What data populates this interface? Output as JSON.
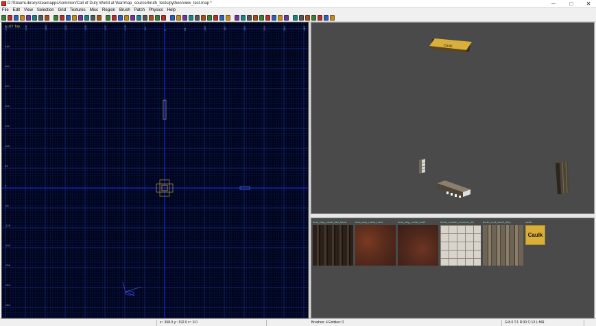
{
  "window": {
    "title": "D:/SteamLibrary/steamapps/common/Call of Duty World at War/map_source/bruth_tests/python/view_test.map *",
    "minimize": "─",
    "maximize": "□",
    "close": "✕"
  },
  "menu": [
    "File",
    "Edit",
    "View",
    "Selection",
    "Grid",
    "Textures",
    "Misc",
    "Region",
    "Brush",
    "Patch",
    "Physics",
    "Help"
  ],
  "toolbar_icons": [
    "open",
    "save",
    "flip-x",
    "flip-y",
    "flip-z",
    "rotate-x",
    "rotate-y",
    "rotate-z",
    "select-complete",
    "select-inside",
    "select-touching",
    "select-partial",
    "csg-subtract",
    "csg-merge",
    "hollow",
    "clipper",
    "change-views",
    "texture-view",
    "camera",
    "entity",
    "cubic-clip",
    "view-x",
    "view-y",
    "view-z",
    "scale",
    "lock",
    "vertex",
    "edge",
    "patch",
    "bend",
    "insert",
    "delete",
    "fog",
    "light",
    "curve",
    "gear",
    "cone",
    "play",
    "bookmark",
    "point",
    "arrow-down",
    "arrow-up",
    "bullet",
    "star",
    "brush",
    "grid",
    "m",
    "b",
    "p",
    "tree",
    "f",
    "mountain"
  ],
  "grid": {
    "view_label": "XY Top",
    "x_ticks": [
      "-512",
      "-448",
      "-384",
      "-320",
      "-256",
      "-192",
      "-128",
      "-64",
      "0",
      "64",
      "128",
      "192",
      "256",
      "320",
      "384",
      "448",
      "512",
      "576"
    ],
    "y_ticks": [
      "512",
      "448",
      "384",
      "320",
      "256",
      "192",
      "128",
      "64",
      "0",
      "-64",
      "-128",
      "-192",
      "-256",
      "-320",
      "-384"
    ]
  },
  "textures": [
    {
      "name": "dust_ship_metal_ribs_band",
      "kind": "ribs"
    },
    {
      "name": "dust_ship_metal_rust1",
      "kind": "rust"
    },
    {
      "name": "dust_ship_metal_rust2",
      "kind": "rust2"
    },
    {
      "name": "berlin_marble_concrete_tile",
      "kind": "tile"
    },
    {
      "name": "berlin_roof_wood_dirty",
      "kind": "planks"
    },
    {
      "name": "caulk",
      "kind": "caulk",
      "label": "Caulk"
    }
  ],
  "status": {
    "coords": "x:: 368.0  y:: 192.0  z:: 0.0",
    "counts": "Brushes: 4 Entities: 0",
    "grid": "G:8.0 T:1 R:30 C:13 L:MR"
  },
  "colors": {
    "grid_bg": "#000418",
    "axis": "#1a2ad8",
    "camera_bg": "#4a4a4a",
    "caulk": "#d9ae3a"
  }
}
